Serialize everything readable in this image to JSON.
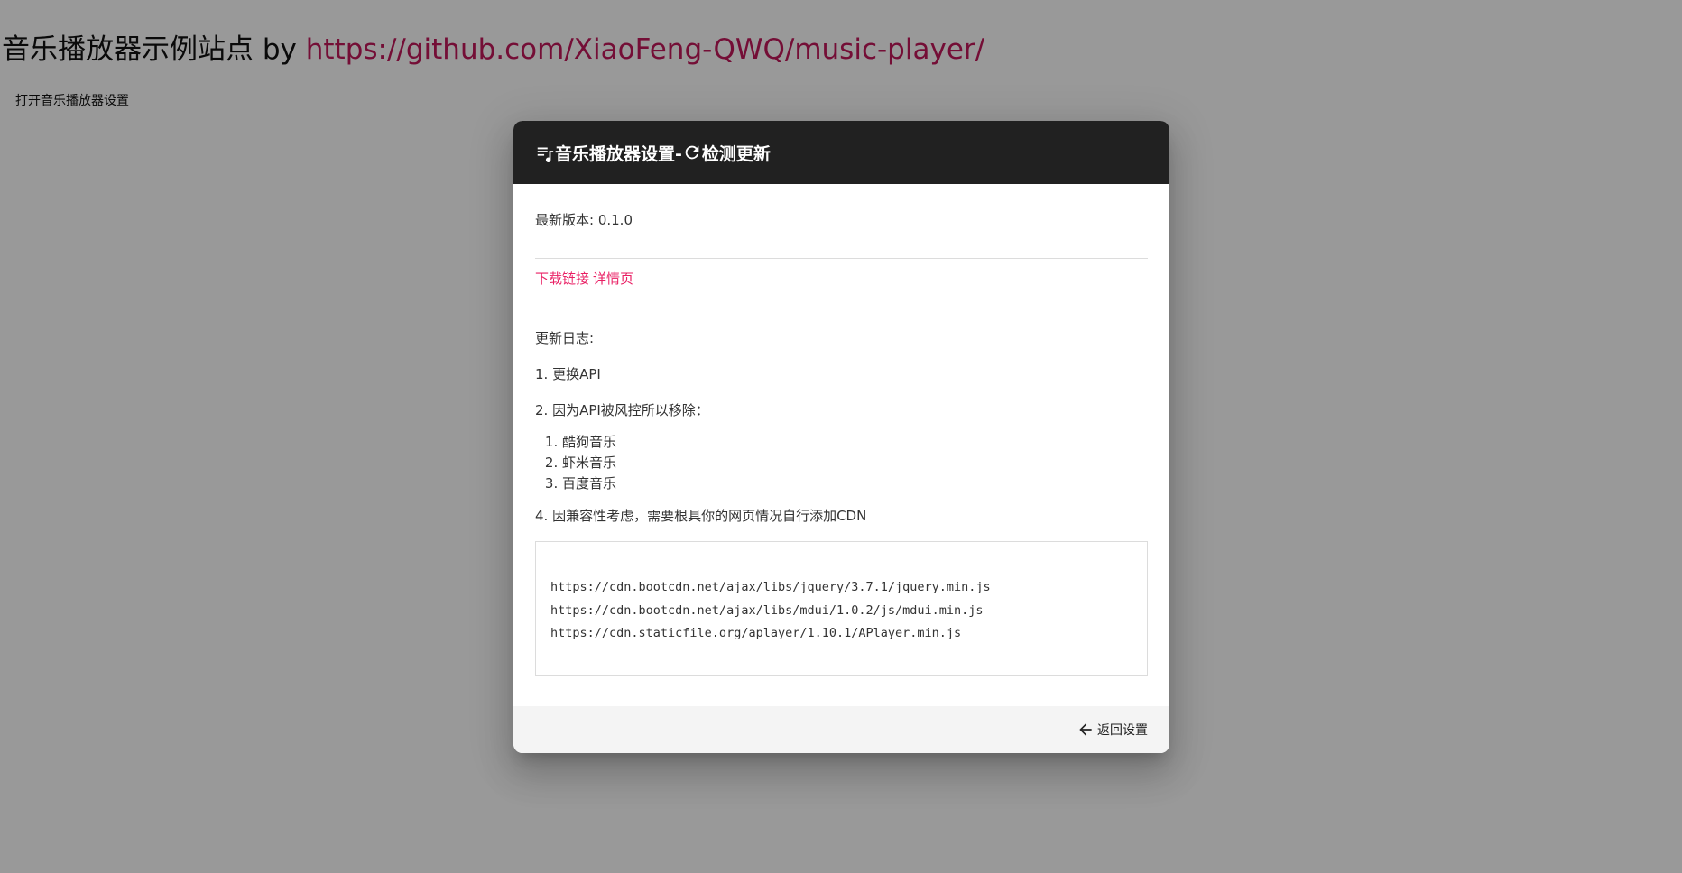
{
  "page": {
    "title_text": "音乐播放器示例站点 by ",
    "title_link": "https://github.com/XiaoFeng-QWQ/music-player/",
    "open_settings_label": "打开音乐播放器设置"
  },
  "dialog": {
    "header_part1": "音乐播放器设置-",
    "header_part2": "检测更新",
    "header_icons": [
      "playlist-music-icon",
      "refresh-icon"
    ],
    "latest_version_label": "最新版本: ",
    "latest_version_value": "0.1.0",
    "download_link_label": "下载链接",
    "detail_link_label": "详情页",
    "changelog_title": "更新日志:",
    "changelog": {
      "item1": "1. 更换API",
      "item2": "2. 因为API被风控所以移除：",
      "removed": [
        "酷狗音乐",
        "虾米音乐",
        "百度音乐"
      ],
      "item4": "4. 因兼容性考虑，需要根具你的网页情况自行添加CDN"
    },
    "cdn_urls": [
      "https://cdn.bootcdn.net/ajax/libs/jquery/3.7.1/jquery.min.js",
      "https://cdn.bootcdn.net/ajax/libs/mdui/1.0.2/js/mdui.min.js",
      "https://cdn.staticfile.org/aplayer/1.10.1/APlayer.min.js"
    ],
    "back_label": "返回设置"
  },
  "colors": {
    "header_bg": "#212121",
    "link_pink": "#e91e63",
    "title_link": "#c2185b",
    "footer_bg": "#f4f4f4"
  }
}
